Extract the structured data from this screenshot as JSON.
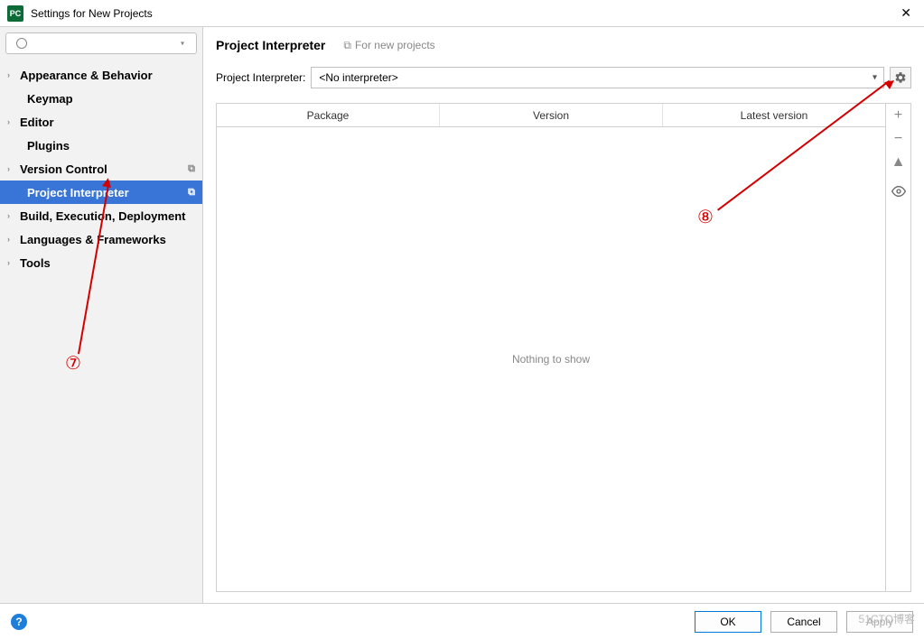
{
  "titlebar": {
    "title": "Settings for New Projects"
  },
  "search": {
    "placeholder": ""
  },
  "sidebar": {
    "items": [
      {
        "label": "Appearance & Behavior",
        "chev": true,
        "bold": true
      },
      {
        "label": "Keymap",
        "bold": true,
        "indent": 1
      },
      {
        "label": "Editor",
        "chev": true,
        "bold": true
      },
      {
        "label": "Plugins",
        "bold": true,
        "indent": 1
      },
      {
        "label": "Version Control",
        "chev": true,
        "bold": true,
        "copy": true
      },
      {
        "label": "Project Interpreter",
        "bold": true,
        "indent": 1,
        "selected": true,
        "copy": true
      },
      {
        "label": "Build, Execution, Deployment",
        "chev": true,
        "bold": true
      },
      {
        "label": "Languages & Frameworks",
        "chev": true,
        "bold": true
      },
      {
        "label": "Tools",
        "chev": true,
        "bold": true
      }
    ]
  },
  "content": {
    "heading": "Project Interpreter",
    "subtext": "For new projects",
    "interpreter_label": "Project Interpreter:",
    "interpreter_value": "<No interpreter>",
    "columns": [
      "Package",
      "Version",
      "Latest version"
    ],
    "empty_text": "Nothing to show"
  },
  "buttons": {
    "ok": "OK",
    "cancel": "Cancel",
    "apply": "Apply"
  },
  "annotations": {
    "n7": "⑦",
    "n8": "⑧"
  },
  "watermark": "51CTO博客"
}
